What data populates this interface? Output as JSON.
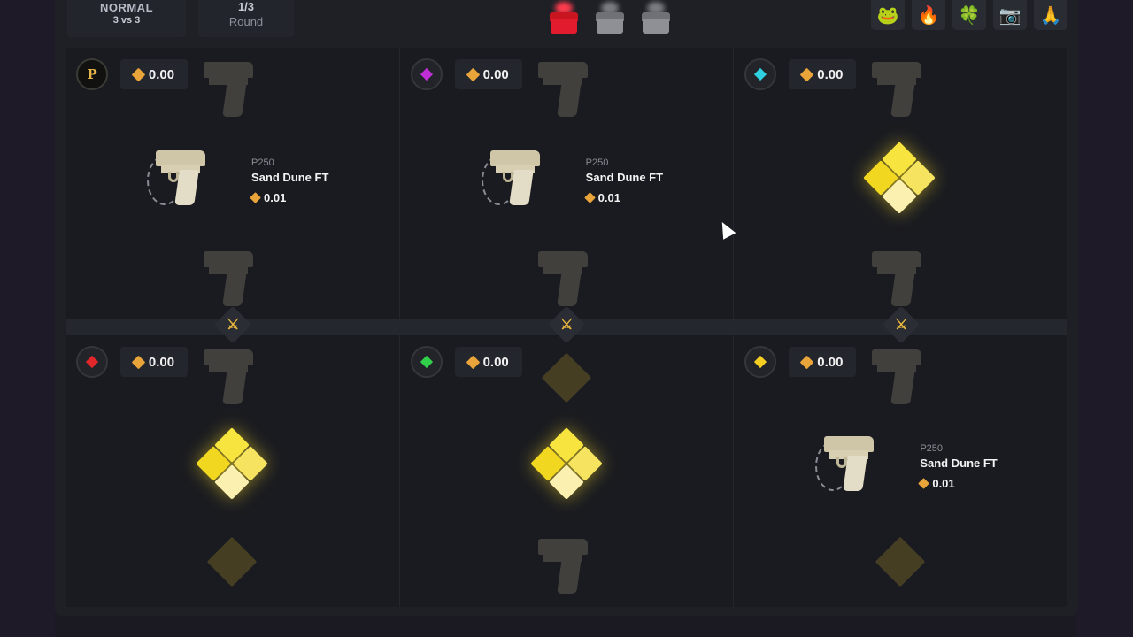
{
  "header": {
    "mode": "NORMAL",
    "mode_sub": "3 vs 3",
    "round_value": "1/3",
    "round_label": "Round",
    "cases": [
      {
        "name": "red-case",
        "color": "#e21c2e"
      },
      {
        "name": "silver-case",
        "color": "#9a9ca2"
      },
      {
        "name": "silver-case",
        "color": "#9a9ca2"
      }
    ],
    "reactions": [
      "🐸",
      "🔥",
      "🍀",
      "📷",
      "🙏"
    ]
  },
  "accent": "#e9a43a",
  "players": [
    {
      "avatar": "P",
      "gem_color": null,
      "balance": "0.00",
      "drop": {
        "kind": "item",
        "type": "P250",
        "name": "Sand Dune FT",
        "price": "0.01"
      }
    },
    {
      "avatar": null,
      "gem_color": "#c02fd6",
      "balance": "0.00",
      "drop": {
        "kind": "item",
        "type": "P250",
        "name": "Sand Dune FT",
        "price": "0.01"
      }
    },
    {
      "avatar": null,
      "gem_color": "#2fd0e0",
      "balance": "0.00",
      "drop": {
        "kind": "gem"
      }
    },
    {
      "avatar": null,
      "gem_color": "#e2272b",
      "balance": "0.00",
      "drop": {
        "kind": "gem"
      }
    },
    {
      "avatar": null,
      "gem_color": "#31d04a",
      "balance": "0.00",
      "drop": {
        "kind": "gem"
      }
    },
    {
      "avatar": null,
      "gem_color": "#f4cf22",
      "balance": "0.00",
      "drop": {
        "kind": "item",
        "type": "P250",
        "name": "Sand Dune FT",
        "price": "0.01"
      }
    }
  ]
}
